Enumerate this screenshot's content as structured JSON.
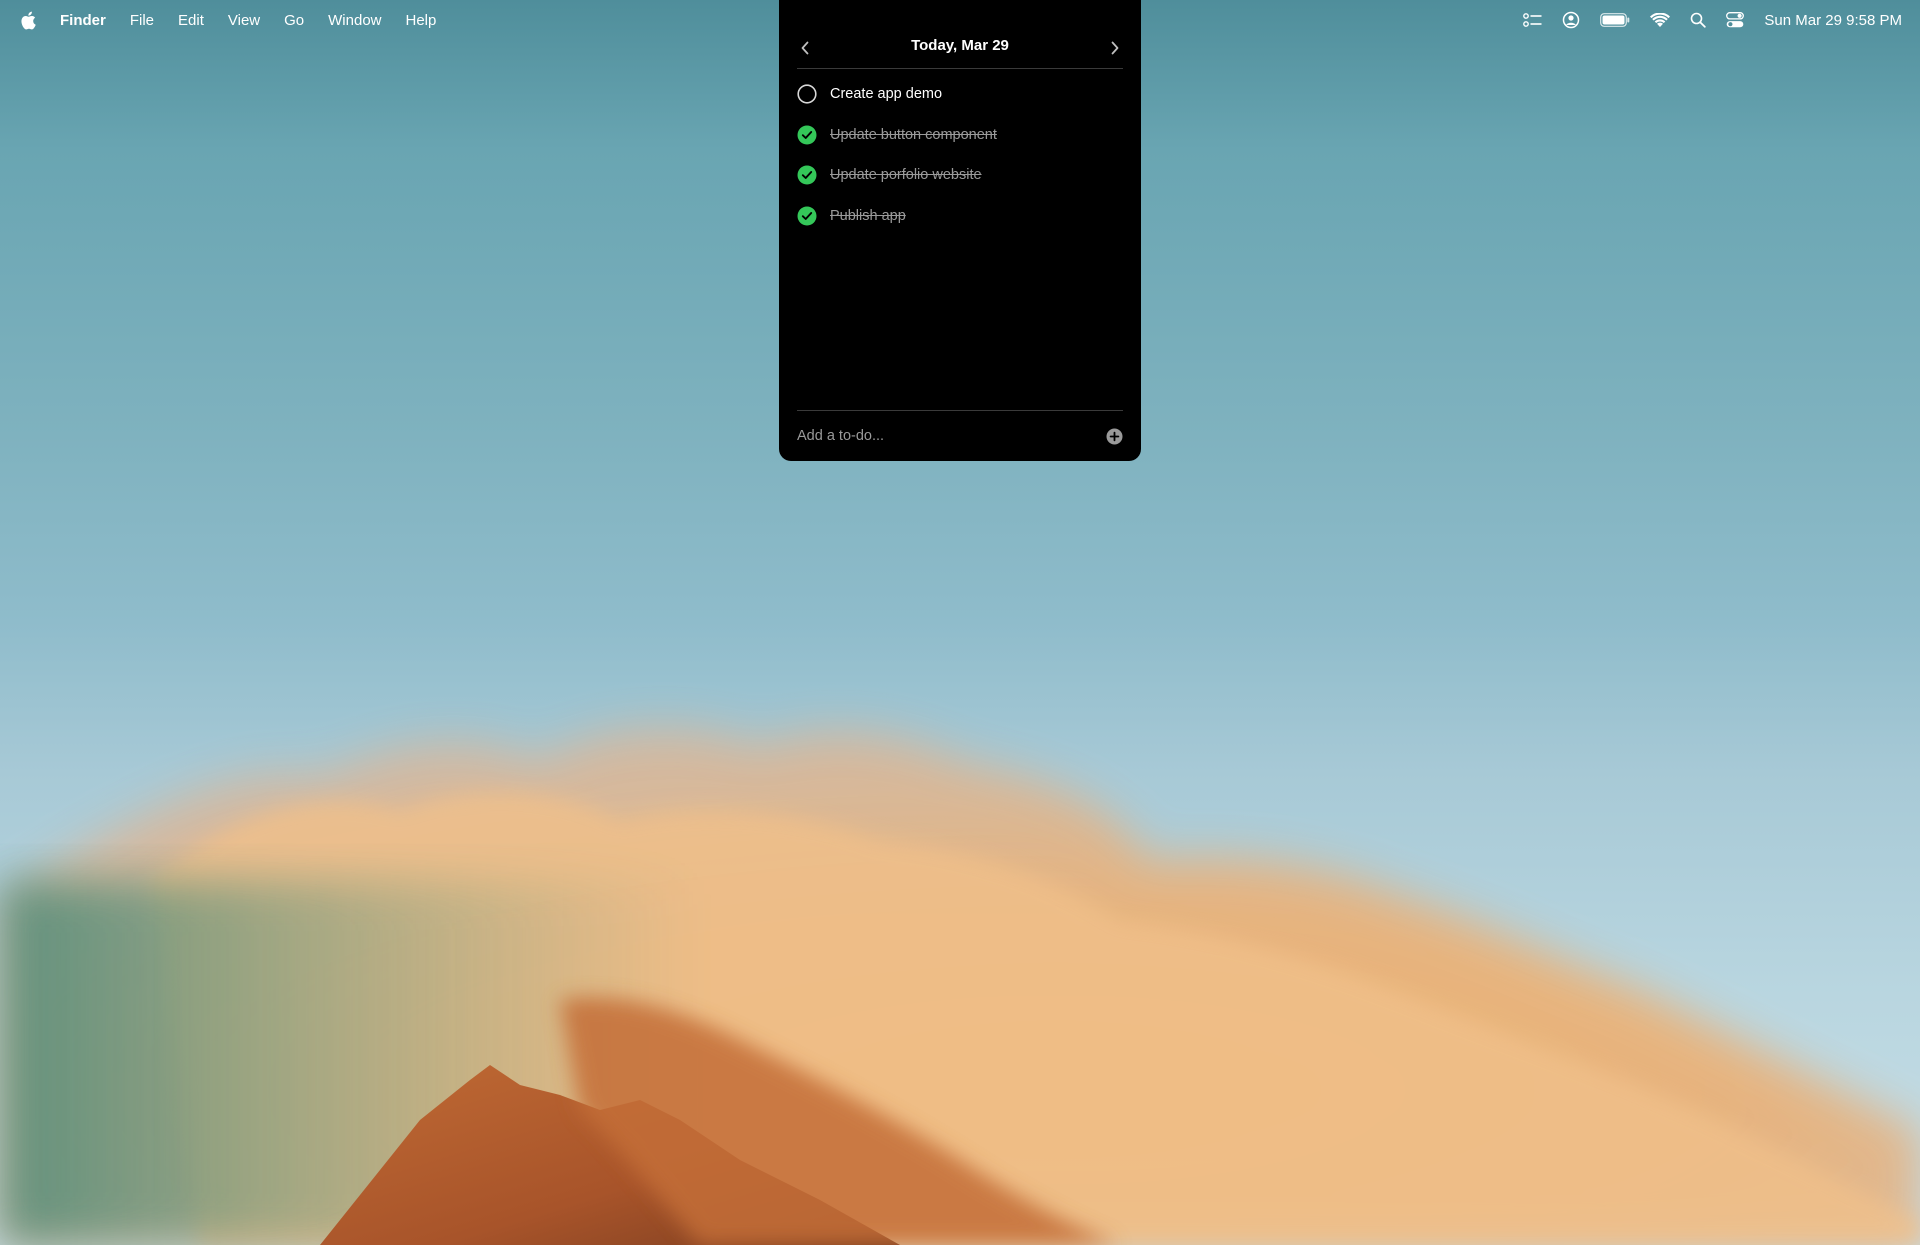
{
  "menubar": {
    "apple_icon": "apple-logo-icon",
    "app_name": "Finder",
    "menus": [
      "File",
      "Edit",
      "View",
      "Go",
      "Window",
      "Help"
    ],
    "status_icons": [
      "checklist-icon",
      "user-account-icon",
      "battery-icon",
      "wifi-icon",
      "search-icon",
      "control-center-icon"
    ],
    "clock": "Sun Mar 29  9:58 PM"
  },
  "todo": {
    "title": "Today, Mar 29",
    "prev_icon": "chevron-left-icon",
    "next_icon": "chevron-right-icon",
    "items": [
      {
        "text": "Create app demo",
        "done": false
      },
      {
        "text": "Update button component",
        "done": true
      },
      {
        "text": "Update porfolio website",
        "done": true
      },
      {
        "text": "Publish app",
        "done": true
      }
    ],
    "add_placeholder": "Add a to-do...",
    "add_icon": "plus-circle-icon",
    "check_color": "#34c759"
  }
}
